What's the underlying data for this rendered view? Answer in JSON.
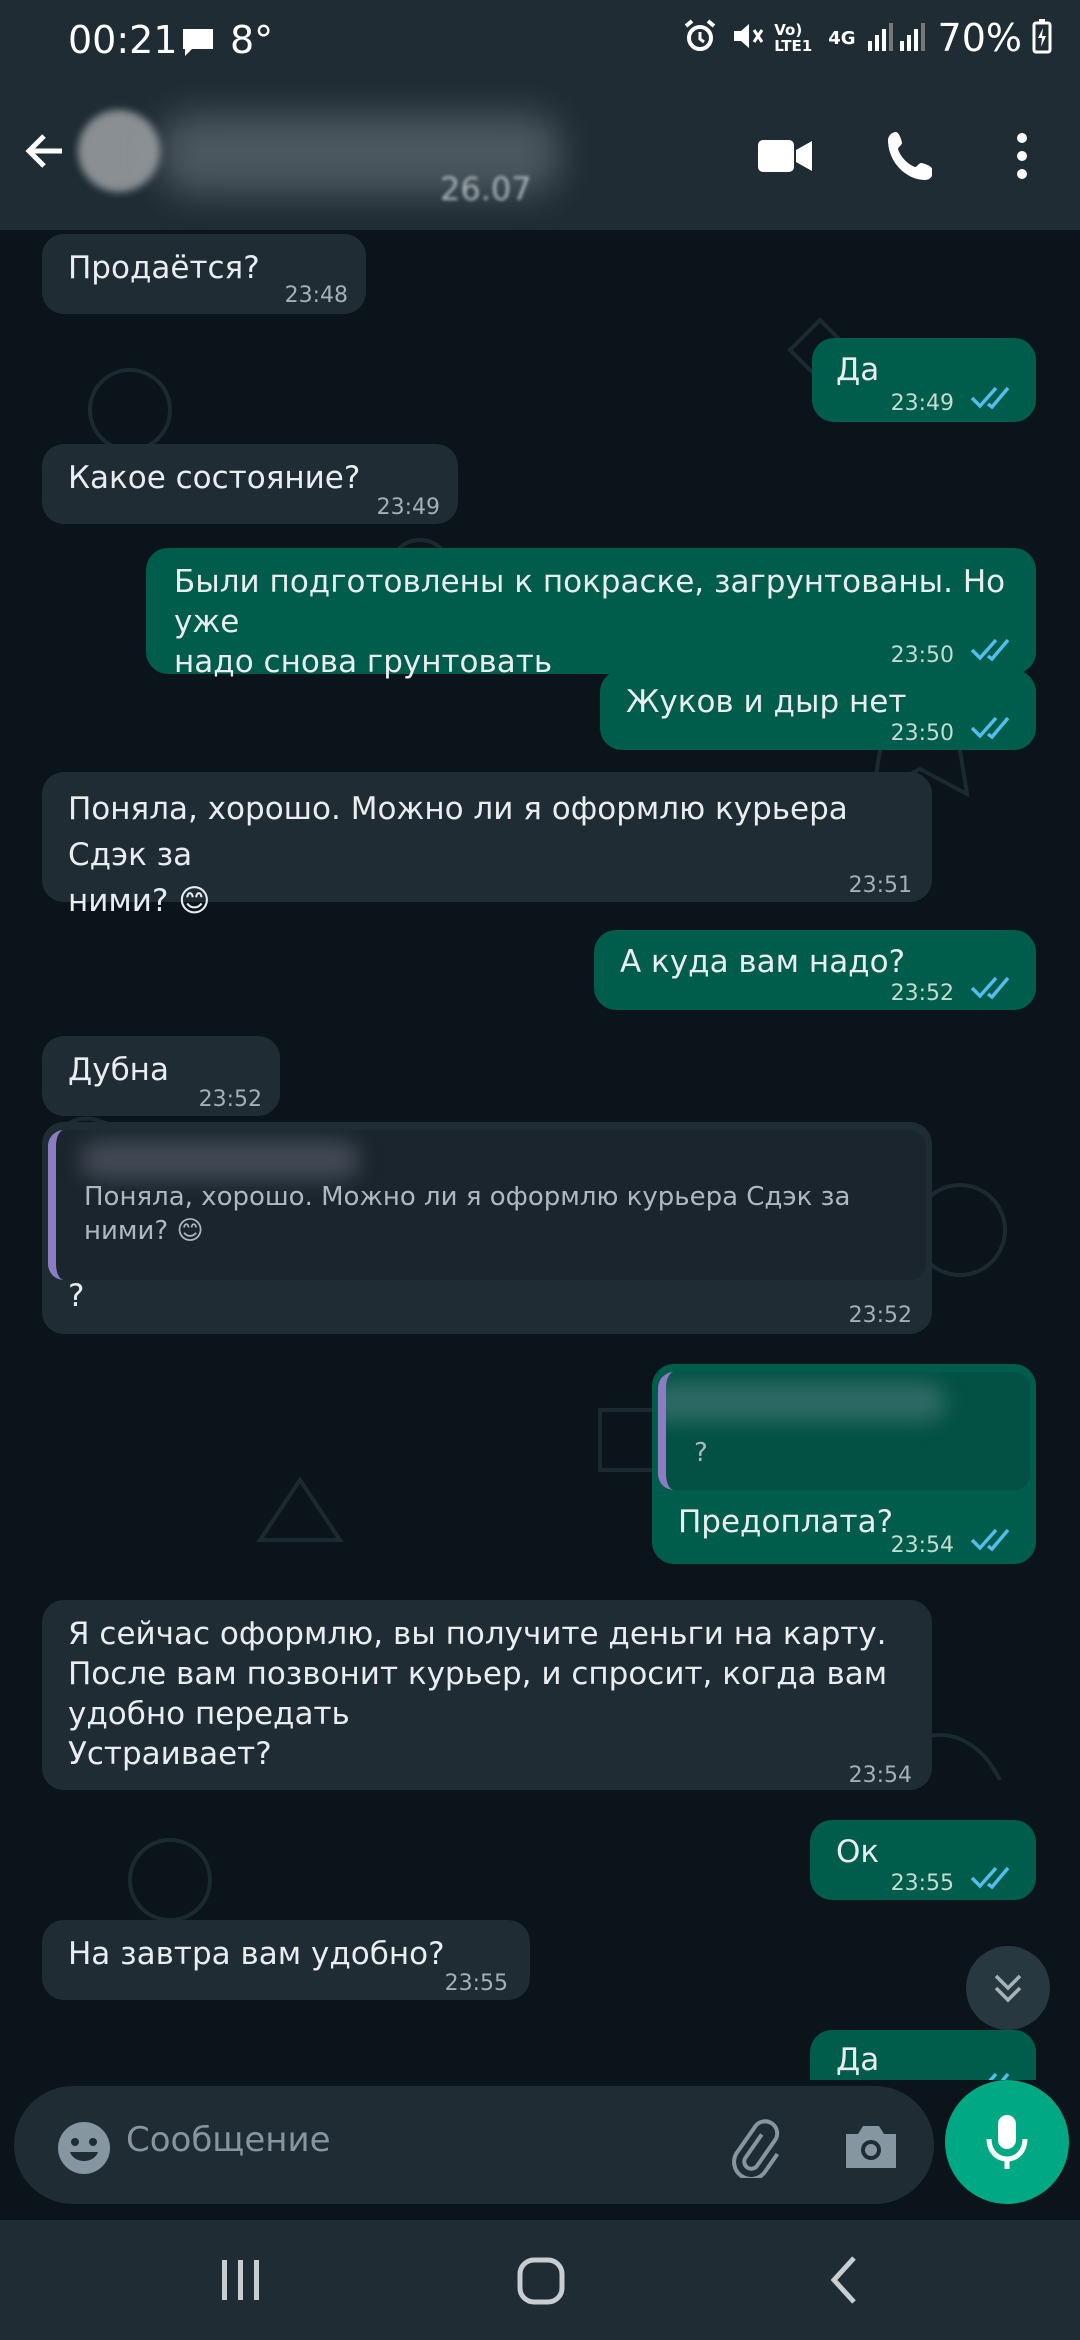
{
  "status_bar": {
    "time": "00:21",
    "temperature": "8°",
    "network": "4G",
    "volte": "Vo) LTE1",
    "battery": "70%"
  },
  "header": {
    "contact_name": "[blurred]",
    "contact_subtitle_fragment": "26.07",
    "icons": [
      "back-arrow-icon",
      "video-call-icon",
      "voice-call-icon",
      "more-options-icon"
    ]
  },
  "messages": [
    {
      "dir": "in",
      "text": "Продаётся?",
      "time": "23:48"
    },
    {
      "dir": "out",
      "text": "Да",
      "time": "23:49",
      "status": "read"
    },
    {
      "dir": "in",
      "text": "Какое состояние?",
      "time": "23:49"
    },
    {
      "dir": "out",
      "text": "Были подготовлены к покраске, загрунтованы. Но уже\nнадо снова грунтовать",
      "time": "23:50",
      "status": "read"
    },
    {
      "dir": "out",
      "text": "Жуков и дыр нет",
      "time": "23:50",
      "status": "read"
    },
    {
      "dir": "in",
      "text": "Поняла, хорошо. Можно ли я оформлю курьера Сдэк за\nними? 😊",
      "time": "23:51"
    },
    {
      "dir": "out",
      "text": "А куда вам надо?",
      "time": "23:52",
      "status": "read"
    },
    {
      "dir": "in",
      "text": "Дубна",
      "time": "23:52"
    },
    {
      "dir": "in",
      "text": "?",
      "time": "23:52",
      "reply_quote": "Поняла, хорошо. Можно ли я оформлю курьера Сдэк за\nними? 😊"
    },
    {
      "dir": "out",
      "text": "Предоплата?",
      "time": "23:54",
      "status": "read",
      "reply_quote": "?"
    },
    {
      "dir": "in",
      "text": "Я сейчас оформлю, вы получите деньги на карту.\nПосле вам позвонит курьер, и спросит, когда вам\nудобно передать\nУстраивает?",
      "time": "23:54"
    },
    {
      "dir": "out",
      "text": "Ок",
      "time": "23:55",
      "status": "read"
    },
    {
      "dir": "in",
      "text": "На завтра вам удобно?",
      "time": "23:55"
    },
    {
      "dir": "out",
      "text": "Да",
      "time": "",
      "status": "read",
      "partially_visible": true
    }
  ],
  "composer": {
    "placeholder": "Сообщение",
    "icons": [
      "emoji-icon",
      "attach-icon",
      "camera-icon",
      "microphone-icon"
    ]
  },
  "colors": {
    "header_bg": "#1f2c34",
    "chat_bg": "#0b141a",
    "incoming_bubble": "#1f2c34",
    "outgoing_bubble": "#005c4b",
    "read_ticks": "#53bdeb",
    "accent": "#00a884",
    "quote_bar": "#8e7cc3"
  }
}
